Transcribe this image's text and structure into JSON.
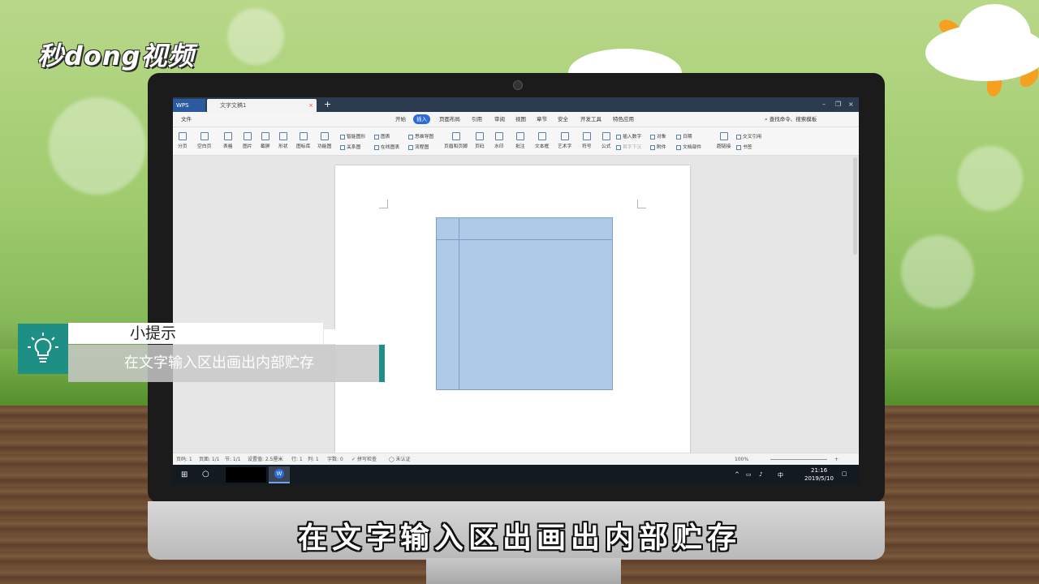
{
  "brand": {
    "logo_text": "秒dong视频"
  },
  "wps": {
    "app_tab": "WPS",
    "doc_tab": "文字文稿1",
    "file_menu": "文件",
    "menus": [
      "开始",
      "插入",
      "页面布局",
      "引用",
      "审阅",
      "视图",
      "章节",
      "安全",
      "开发工具",
      "特色应用"
    ],
    "active_menu": "插入",
    "search_placeholder": "查找命令、搜索模板",
    "ribbon_large": [
      "分页",
      "空白页",
      "表格",
      "图片",
      "截屏",
      "形状",
      "图标库",
      "功能图",
      "页眉和页脚",
      "页码",
      "水印",
      "批注",
      "文本框",
      "艺术字",
      "符号",
      "公式",
      "超链接",
      "书签"
    ],
    "ribbon_small": [
      "智能图形",
      "图表",
      "思维导图",
      "关系图",
      "在线图表",
      "流程图",
      "插入数字",
      "对象",
      "日期",
      "附件",
      "文档部件",
      "交叉引用",
      "首字下沉"
    ],
    "status": {
      "page": "页码: 1",
      "pages": "页面: 1/1",
      "section": "节: 1/1",
      "setting": "设置值: 2.5厘米",
      "row": "行: 1",
      "col": "列: 1",
      "words": "字数: 0",
      "spell": "拼写检查",
      "cert": "未认证",
      "zoom": "100%"
    },
    "clock": {
      "time": "21:16",
      "date": "2019/5/10"
    },
    "ime": "中"
  },
  "tip": {
    "title": "小提示",
    "text": "在文字输入区出画出内部贮存"
  },
  "subtitle": "在文字输入区出画出内部贮存"
}
